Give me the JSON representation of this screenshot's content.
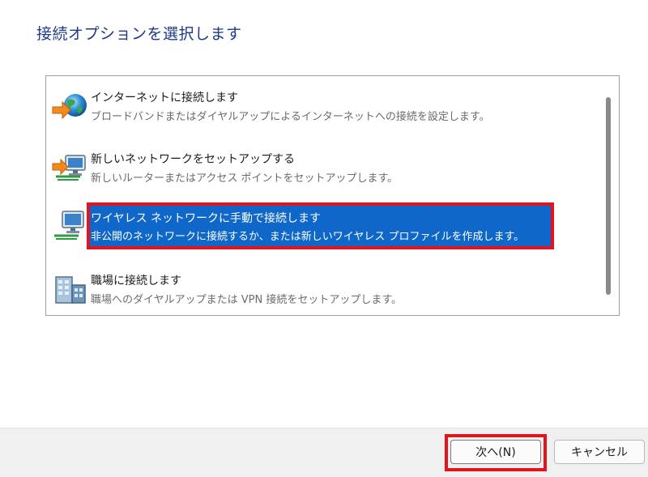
{
  "page": {
    "title": "接続オプションを選択します"
  },
  "options": [
    {
      "title": "インターネットに接続します",
      "description": "ブロードバンドまたはダイヤルアップによるインターネットへの接続を設定します。",
      "icon": "globe-arrow-icon"
    },
    {
      "title": "新しいネットワークをセットアップする",
      "description": "新しいルーターまたはアクセス ポイントをセットアップします。",
      "icon": "network-arrow-icon"
    },
    {
      "title": "ワイヤレス ネットワークに手動で接続します",
      "description": "非公開のネットワークに接続するか、または新しいワイヤレス プロファイルを作成します。",
      "icon": "wireless-monitor-icon",
      "selected": true
    },
    {
      "title": "職場に接続します",
      "description": "職場へのダイヤルアップまたは VPN 接続をセットアップします。",
      "icon": "workplace-building-icon"
    }
  ],
  "footer": {
    "next_label": "次へ(N)",
    "cancel_label": "キャンセル"
  },
  "colors": {
    "title": "#1e3a8a",
    "selection": "#0f67c9",
    "highlight": "#e3141b"
  }
}
